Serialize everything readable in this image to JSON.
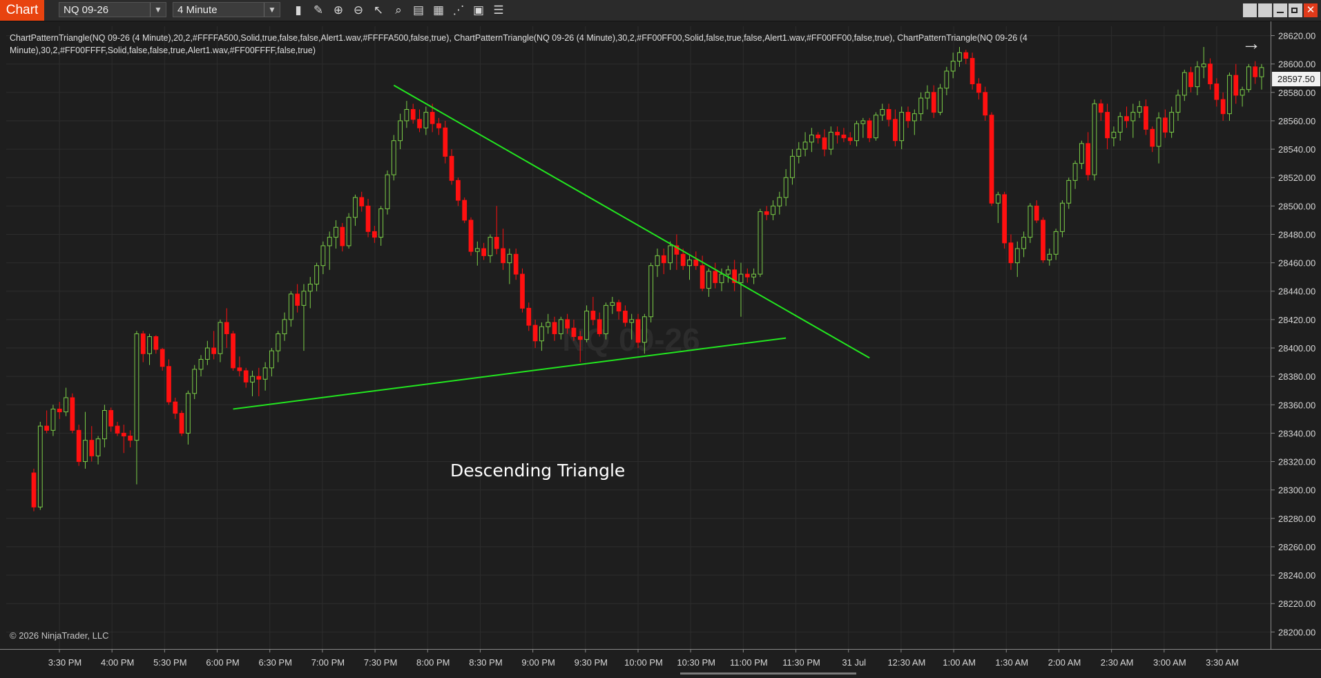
{
  "app": {
    "tab_label": "Chart"
  },
  "toolbar": {
    "instrument": "NQ 09-26",
    "interval": "4 Minute",
    "tools": [
      {
        "name": "bar-type-icon",
        "glyph": "▮"
      },
      {
        "name": "drawing-tools-icon",
        "glyph": "✎"
      },
      {
        "name": "zoom-in-icon",
        "glyph": "⊕"
      },
      {
        "name": "zoom-out-icon",
        "glyph": "⊖"
      },
      {
        "name": "pointer-icon",
        "glyph": "↖"
      },
      {
        "name": "data-box-icon",
        "glyph": "⌕"
      },
      {
        "name": "templates-icon",
        "glyph": "▤"
      },
      {
        "name": "indicators-icon",
        "glyph": "▦"
      },
      {
        "name": "strategies-icon",
        "glyph": "⋰"
      },
      {
        "name": "properties-icon",
        "glyph": "▣"
      },
      {
        "name": "menu-icon",
        "glyph": "☰"
      }
    ]
  },
  "indicator_label": "ChartPatternTriangle(NQ 09-26 (4 Minute),20,2,#FFFFA500,Solid,true,false,false,Alert1.wav,#FFFFA500,false,true), ChartPatternTriangle(NQ 09-26 (4 Minute),30,2,#FF00FF00,Solid,false,true,false,Alert1.wav,#FF00FF00,false,true), ChartPatternTriangle(NQ 09-26 (4 Minute),30,2,#FF00FFFF,Solid,false,false,true,Alert1.wav,#FF00FFFF,false,true)",
  "copyright": "© 2026 NinjaTrader, LLC",
  "pattern_label": "Descending Triangle",
  "watermark": "NQ 09-26",
  "last_price": "28597.50",
  "colors": {
    "up_candle_outline": "#7ccf48",
    "down_candle": "#ff1010",
    "trendline": "#22e81f",
    "background": "#1e1e1e",
    "tab_accent": "#e8430f"
  },
  "chart_data": {
    "type": "candlestick",
    "title": "",
    "y_ticks": [
      28200,
      28220,
      28240,
      28260,
      28280,
      28300,
      28320,
      28340,
      28360,
      28380,
      28400,
      28420,
      28440,
      28460,
      28480,
      28500,
      28520,
      28540,
      28560,
      28580,
      28600,
      28620
    ],
    "y_tick_labels": [
      "28200.00",
      "28220.00",
      "28240.00",
      "28260.00",
      "28280.00",
      "28300.00",
      "28320.00",
      "28340.00",
      "28360.00",
      "28380.00",
      "28400.00",
      "28420.00",
      "28440.00",
      "28460.00",
      "28480.00",
      "28500.00",
      "28520.00",
      "28540.00",
      "28560.00",
      "28580.00",
      "28600.00",
      "28620.00"
    ],
    "ylim": [
      28188,
      28630
    ],
    "x_ticks": [
      "3:30 PM",
      "4:00 PM",
      "5:30 PM",
      "6:00 PM",
      "6:30 PM",
      "7:00 PM",
      "7:30 PM",
      "8:00 PM",
      "8:30 PM",
      "9:00 PM",
      "9:30 PM",
      "10:00 PM",
      "10:30 PM",
      "11:00 PM",
      "11:30 PM",
      "31 Jul",
      "12:30 AM",
      "1:00 AM",
      "1:30 AM",
      "2:00 AM",
      "2:30 AM",
      "3:00 AM",
      "3:30 AM"
    ],
    "grid": true,
    "trendlines": [
      {
        "name": "upper",
        "from_bar": 56,
        "from_price": 28585,
        "to_bar": 130,
        "to_price": 28393
      },
      {
        "name": "lower",
        "from_bar": 31,
        "from_price": 28357,
        "to_bar": 117,
        "to_price": 28407
      }
    ],
    "candles": [
      [
        28312,
        28315,
        28285,
        28288
      ],
      [
        28288,
        28348,
        28286,
        28345
      ],
      [
        28345,
        28356,
        28340,
        28342
      ],
      [
        28342,
        28360,
        28338,
        28357
      ],
      [
        28357,
        28362,
        28350,
        28355
      ],
      [
        28355,
        28372,
        28352,
        28365
      ],
      [
        28365,
        28368,
        28340,
        28342
      ],
      [
        28342,
        28346,
        28317,
        28320
      ],
      [
        28320,
        28355,
        28315,
        28335
      ],
      [
        28335,
        28345,
        28320,
        28324
      ],
      [
        28324,
        28338,
        28318,
        28336
      ],
      [
        28336,
        28360,
        28330,
        28356
      ],
      [
        28356,
        28358,
        28341,
        28345
      ],
      [
        28345,
        28348,
        28338,
        28340
      ],
      [
        28340,
        28346,
        28326,
        28338
      ],
      [
        28338,
        28342,
        28330,
        28335
      ],
      [
        28335,
        28412,
        28304,
        28410
      ],
      [
        28410,
        28412,
        28390,
        28396
      ],
      [
        28396,
        28410,
        28388,
        28408
      ],
      [
        28408,
        28409,
        28396,
        28399
      ],
      [
        28399,
        28400,
        28384,
        28387
      ],
      [
        28387,
        28392,
        28360,
        28362
      ],
      [
        28362,
        28365,
        28350,
        28354
      ],
      [
        28354,
        28356,
        28338,
        28340
      ],
      [
        28340,
        28370,
        28332,
        28368
      ],
      [
        28368,
        28388,
        28364,
        28385
      ],
      [
        28385,
        28395,
        28380,
        28392
      ],
      [
        28392,
        28405,
        28388,
        28400
      ],
      [
        28400,
        28412,
        28392,
        28396
      ],
      [
        28396,
        28420,
        28390,
        28418
      ],
      [
        28418,
        28428,
        28400,
        28410
      ],
      [
        28410,
        28412,
        28384,
        28386
      ],
      [
        28386,
        28394,
        28380,
        28384
      ],
      [
        28384,
        28386,
        28372,
        28376
      ],
      [
        28376,
        28384,
        28366,
        28380
      ],
      [
        28380,
        28386,
        28366,
        28378
      ],
      [
        28378,
        28390,
        28370,
        28386
      ],
      [
        28386,
        28400,
        28380,
        28398
      ],
      [
        28398,
        28412,
        28390,
        28410
      ],
      [
        28410,
        28425,
        28405,
        28420
      ],
      [
        28420,
        28440,
        28415,
        28438
      ],
      [
        28438,
        28445,
        28425,
        28430
      ],
      [
        28430,
        28445,
        28398,
        28440
      ],
      [
        28440,
        28450,
        28428,
        28445
      ],
      [
        28445,
        28460,
        28440,
        28458
      ],
      [
        28458,
        28475,
        28452,
        28472
      ],
      [
        28472,
        28482,
        28455,
        28478
      ],
      [
        28478,
        28490,
        28470,
        28485
      ],
      [
        28485,
        28488,
        28468,
        28472
      ],
      [
        28472,
        28495,
        28470,
        28492
      ],
      [
        28492,
        28508,
        28486,
        28506
      ],
      [
        28506,
        28510,
        28496,
        28500
      ],
      [
        28500,
        28505,
        28478,
        28482
      ],
      [
        28482,
        28486,
        28474,
        28478
      ],
      [
        28478,
        28500,
        28472,
        28498
      ],
      [
        28498,
        28525,
        28494,
        28522
      ],
      [
        28522,
        28550,
        28518,
        28546
      ],
      [
        28546,
        28565,
        28540,
        28560
      ],
      [
        28560,
        28574,
        28555,
        28568
      ],
      [
        28568,
        28572,
        28558,
        28561
      ],
      [
        28561,
        28568,
        28552,
        28555
      ],
      [
        28555,
        28570,
        28550,
        28566
      ],
      [
        28566,
        28572,
        28552,
        28558
      ],
      [
        28558,
        28562,
        28550,
        28555
      ],
      [
        28555,
        28560,
        28530,
        28535
      ],
      [
        28535,
        28540,
        28515,
        28518
      ],
      [
        28518,
        28520,
        28500,
        28504
      ],
      [
        28504,
        28506,
        28488,
        28490
      ],
      [
        28490,
        28492,
        28465,
        28468
      ],
      [
        28468,
        28475,
        28458,
        28470
      ],
      [
        28470,
        28474,
        28462,
        28465
      ],
      [
        28465,
        28480,
        28460,
        28478
      ],
      [
        28478,
        28500,
        28466,
        28470
      ],
      [
        28470,
        28484,
        28455,
        28460
      ],
      [
        28460,
        28470,
        28445,
        28466
      ],
      [
        28466,
        28470,
        28448,
        28452
      ],
      [
        28452,
        28456,
        28425,
        28428
      ],
      [
        28428,
        28432,
        28412,
        28416
      ],
      [
        28416,
        28420,
        28400,
        28405
      ],
      [
        28405,
        28418,
        28398,
        28415
      ],
      [
        28415,
        28424,
        28410,
        28418
      ],
      [
        28418,
        28422,
        28405,
        28410
      ],
      [
        28410,
        28422,
        28406,
        28420
      ],
      [
        28420,
        28424,
        28410,
        28414
      ],
      [
        28414,
        28420,
        28405,
        28408
      ],
      [
        28408,
        28412,
        28390,
        28406
      ],
      [
        28406,
        28430,
        28404,
        28426
      ],
      [
        28426,
        28436,
        28416,
        28420
      ],
      [
        28420,
        28425,
        28408,
        28410
      ],
      [
        28410,
        28432,
        28406,
        28430
      ],
      [
        28430,
        28436,
        28424,
        28432
      ],
      [
        28432,
        28434,
        28420,
        28426
      ],
      [
        28426,
        28430,
        28415,
        28418
      ],
      [
        28418,
        28424,
        28406,
        28420
      ],
      [
        28420,
        28424,
        28400,
        28404
      ],
      [
        28404,
        28424,
        28396,
        28422
      ],
      [
        28422,
        28460,
        28418,
        28458
      ],
      [
        28458,
        28470,
        28450,
        28465
      ],
      [
        28465,
        28470,
        28452,
        28460
      ],
      [
        28460,
        28475,
        28455,
        28472
      ],
      [
        28472,
        28480,
        28455,
        28466
      ],
      [
        28466,
        28470,
        28455,
        28458
      ],
      [
        28458,
        28465,
        28448,
        28462
      ],
      [
        28462,
        28468,
        28455,
        28458
      ],
      [
        28458,
        28465,
        28440,
        28442
      ],
      [
        28442,
        28456,
        28436,
        28454
      ],
      [
        28454,
        28460,
        28442,
        28446
      ],
      [
        28446,
        28456,
        28440,
        28452
      ],
      [
        28452,
        28458,
        28446,
        28455
      ],
      [
        28455,
        28462,
        28440,
        28446
      ],
      [
        28446,
        28460,
        28422,
        28452
      ],
      [
        28452,
        28456,
        28446,
        28450
      ],
      [
        28450,
        28456,
        28445,
        28452
      ],
      [
        28452,
        28498,
        28450,
        28496
      ],
      [
        28496,
        28500,
        28490,
        28494
      ],
      [
        28494,
        28504,
        28490,
        28500
      ],
      [
        28500,
        28510,
        28494,
        28506
      ],
      [
        28506,
        28526,
        28500,
        28520
      ],
      [
        28520,
        28540,
        28515,
        28535
      ],
      [
        28535,
        28545,
        28530,
        28540
      ],
      [
        28540,
        28552,
        28535,
        28545
      ],
      [
        28545,
        28555,
        28538,
        28550
      ],
      [
        28550,
        28552,
        28544,
        28548
      ],
      [
        28548,
        28554,
        28535,
        28540
      ],
      [
        28540,
        28556,
        28536,
        28552
      ],
      [
        28552,
        28556,
        28544,
        28550
      ],
      [
        28550,
        28555,
        28545,
        28548
      ],
      [
        28548,
        28552,
        28543,
        28546
      ],
      [
        28546,
        28560,
        28542,
        28558
      ],
      [
        28558,
        28562,
        28548,
        28560
      ],
      [
        28560,
        28562,
        28545,
        28548
      ],
      [
        28548,
        28566,
        28546,
        28564
      ],
      [
        28564,
        28572,
        28560,
        28568
      ],
      [
        28568,
        28572,
        28556,
        28561
      ],
      [
        28561,
        28568,
        28542,
        28546
      ],
      [
        28546,
        28570,
        28540,
        28566
      ],
      [
        28566,
        28570,
        28555,
        28560
      ],
      [
        28560,
        28568,
        28550,
        28565
      ],
      [
        28565,
        28580,
        28560,
        28576
      ],
      [
        28576,
        28585,
        28568,
        28580
      ],
      [
        28580,
        28585,
        28562,
        28566
      ],
      [
        28566,
        28586,
        28564,
        28583
      ],
      [
        28583,
        28598,
        28578,
        28595
      ],
      [
        28595,
        28608,
        28590,
        28602
      ],
      [
        28602,
        28612,
        28598,
        28608
      ],
      [
        28608,
        28610,
        28600,
        28604
      ],
      [
        28604,
        28608,
        28582,
        28586
      ],
      [
        28586,
        28590,
        28575,
        28580
      ],
      [
        28580,
        28584,
        28560,
        28564
      ],
      [
        28564,
        28566,
        28500,
        28502
      ],
      [
        28502,
        28510,
        28488,
        28508
      ],
      [
        28508,
        28510,
        28470,
        28474
      ],
      [
        28474,
        28480,
        28455,
        28460
      ],
      [
        28460,
        28475,
        28450,
        28470
      ],
      [
        28470,
        28482,
        28464,
        28478
      ],
      [
        28478,
        28502,
        28474,
        28500
      ],
      [
        28500,
        28504,
        28488,
        28490
      ],
      [
        28490,
        28492,
        28460,
        28462
      ],
      [
        28462,
        28470,
        28458,
        28466
      ],
      [
        28466,
        28484,
        28462,
        28482
      ],
      [
        28482,
        28504,
        28478,
        28502
      ],
      [
        28502,
        28520,
        28498,
        28518
      ],
      [
        28518,
        28532,
        28512,
        28530
      ],
      [
        28530,
        28546,
        28526,
        28544
      ],
      [
        28544,
        28552,
        28518,
        28522
      ],
      [
        28522,
        28575,
        28518,
        28572
      ],
      [
        28572,
        28575,
        28560,
        28566
      ],
      [
        28566,
        28572,
        28540,
        28548
      ],
      [
        28548,
        28556,
        28542,
        28552
      ],
      [
        28552,
        28566,
        28546,
        28563
      ],
      [
        28563,
        28570,
        28555,
        28560
      ],
      [
        28560,
        28572,
        28548,
        28566
      ],
      [
        28566,
        28574,
        28562,
        28570
      ],
      [
        28570,
        28575,
        28550,
        28554
      ],
      [
        28554,
        28556,
        28538,
        28542
      ],
      [
        28542,
        28566,
        28530,
        28562
      ],
      [
        28562,
        28568,
        28548,
        28552
      ],
      [
        28552,
        28570,
        28548,
        28566
      ],
      [
        28566,
        28582,
        28560,
        28578
      ],
      [
        28578,
        28596,
        28574,
        28594
      ],
      [
        28594,
        28598,
        28580,
        28584
      ],
      [
        28584,
        28602,
        28578,
        28598
      ],
      [
        28598,
        28612,
        28590,
        28600
      ],
      [
        28600,
        28604,
        28582,
        28586
      ],
      [
        28586,
        28590,
        28570,
        28575
      ],
      [
        28575,
        28580,
        28560,
        28565
      ],
      [
        28565,
        28594,
        28560,
        28592
      ],
      [
        28592,
        28600,
        28572,
        28578
      ],
      [
        28578,
        28584,
        28570,
        28582
      ],
      [
        28582,
        28600,
        28580,
        28598
      ],
      [
        28598,
        28602,
        28586,
        28591
      ],
      [
        28591,
        28600,
        28582,
        28597.5
      ]
    ]
  }
}
